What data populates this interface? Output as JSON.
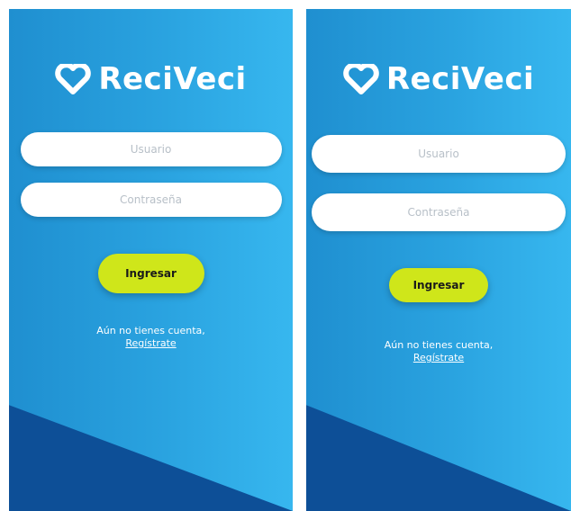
{
  "brand": {
    "name": "ReciVeci"
  },
  "login_screen_1": {
    "username_placeholder": "Usuario",
    "password_placeholder": "Contraseña",
    "submit_label": "Ingresar",
    "signup_prompt": "Aún no tienes cuenta,",
    "signup_link": "Regístrate"
  },
  "login_screen_2": {
    "username_placeholder": "Usuario",
    "password_placeholder": "Contraseña",
    "submit_label": "Ingresar",
    "signup_prompt": "Aún no tienes cuenta,",
    "signup_link": "Regístrate"
  },
  "colors": {
    "background_gradient_start": "#1f8fd0",
    "background_gradient_end": "#37b7ef",
    "bottom_shape": "#0d4f97",
    "button": "#cfe61a"
  },
  "icons": {
    "logo": "heart-icon"
  }
}
